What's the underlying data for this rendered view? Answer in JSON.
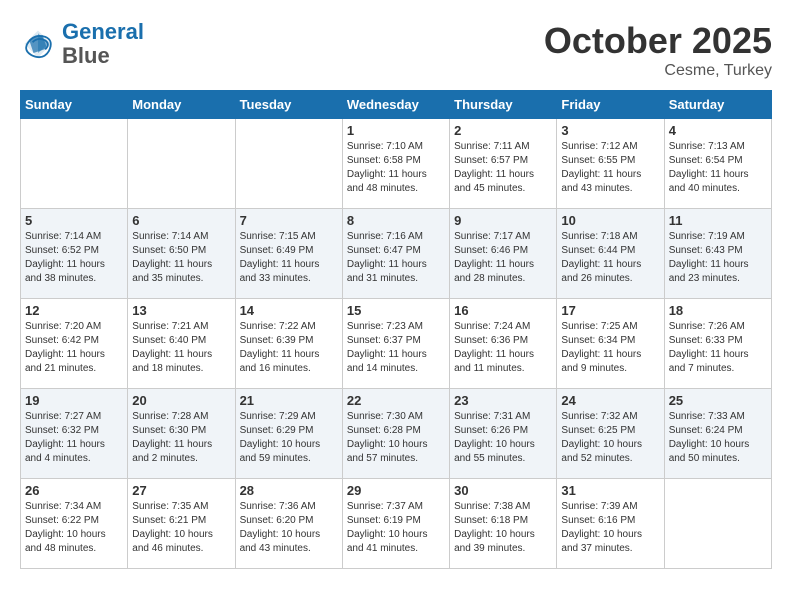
{
  "header": {
    "logo_line1": "General",
    "logo_line2": "Blue",
    "month": "October 2025",
    "location": "Cesme, Turkey"
  },
  "weekdays": [
    "Sunday",
    "Monday",
    "Tuesday",
    "Wednesday",
    "Thursday",
    "Friday",
    "Saturday"
  ],
  "weeks": [
    [
      {
        "day": "",
        "info": ""
      },
      {
        "day": "",
        "info": ""
      },
      {
        "day": "",
        "info": ""
      },
      {
        "day": "1",
        "info": "Sunrise: 7:10 AM\nSunset: 6:58 PM\nDaylight: 11 hours\nand 48 minutes."
      },
      {
        "day": "2",
        "info": "Sunrise: 7:11 AM\nSunset: 6:57 PM\nDaylight: 11 hours\nand 45 minutes."
      },
      {
        "day": "3",
        "info": "Sunrise: 7:12 AM\nSunset: 6:55 PM\nDaylight: 11 hours\nand 43 minutes."
      },
      {
        "day": "4",
        "info": "Sunrise: 7:13 AM\nSunset: 6:54 PM\nDaylight: 11 hours\nand 40 minutes."
      }
    ],
    [
      {
        "day": "5",
        "info": "Sunrise: 7:14 AM\nSunset: 6:52 PM\nDaylight: 11 hours\nand 38 minutes."
      },
      {
        "day": "6",
        "info": "Sunrise: 7:14 AM\nSunset: 6:50 PM\nDaylight: 11 hours\nand 35 minutes."
      },
      {
        "day": "7",
        "info": "Sunrise: 7:15 AM\nSunset: 6:49 PM\nDaylight: 11 hours\nand 33 minutes."
      },
      {
        "day": "8",
        "info": "Sunrise: 7:16 AM\nSunset: 6:47 PM\nDaylight: 11 hours\nand 31 minutes."
      },
      {
        "day": "9",
        "info": "Sunrise: 7:17 AM\nSunset: 6:46 PM\nDaylight: 11 hours\nand 28 minutes."
      },
      {
        "day": "10",
        "info": "Sunrise: 7:18 AM\nSunset: 6:44 PM\nDaylight: 11 hours\nand 26 minutes."
      },
      {
        "day": "11",
        "info": "Sunrise: 7:19 AM\nSunset: 6:43 PM\nDaylight: 11 hours\nand 23 minutes."
      }
    ],
    [
      {
        "day": "12",
        "info": "Sunrise: 7:20 AM\nSunset: 6:42 PM\nDaylight: 11 hours\nand 21 minutes."
      },
      {
        "day": "13",
        "info": "Sunrise: 7:21 AM\nSunset: 6:40 PM\nDaylight: 11 hours\nand 18 minutes."
      },
      {
        "day": "14",
        "info": "Sunrise: 7:22 AM\nSunset: 6:39 PM\nDaylight: 11 hours\nand 16 minutes."
      },
      {
        "day": "15",
        "info": "Sunrise: 7:23 AM\nSunset: 6:37 PM\nDaylight: 11 hours\nand 14 minutes."
      },
      {
        "day": "16",
        "info": "Sunrise: 7:24 AM\nSunset: 6:36 PM\nDaylight: 11 hours\nand 11 minutes."
      },
      {
        "day": "17",
        "info": "Sunrise: 7:25 AM\nSunset: 6:34 PM\nDaylight: 11 hours\nand 9 minutes."
      },
      {
        "day": "18",
        "info": "Sunrise: 7:26 AM\nSunset: 6:33 PM\nDaylight: 11 hours\nand 7 minutes."
      }
    ],
    [
      {
        "day": "19",
        "info": "Sunrise: 7:27 AM\nSunset: 6:32 PM\nDaylight: 11 hours\nand 4 minutes."
      },
      {
        "day": "20",
        "info": "Sunrise: 7:28 AM\nSunset: 6:30 PM\nDaylight: 11 hours\nand 2 minutes."
      },
      {
        "day": "21",
        "info": "Sunrise: 7:29 AM\nSunset: 6:29 PM\nDaylight: 10 hours\nand 59 minutes."
      },
      {
        "day": "22",
        "info": "Sunrise: 7:30 AM\nSunset: 6:28 PM\nDaylight: 10 hours\nand 57 minutes."
      },
      {
        "day": "23",
        "info": "Sunrise: 7:31 AM\nSunset: 6:26 PM\nDaylight: 10 hours\nand 55 minutes."
      },
      {
        "day": "24",
        "info": "Sunrise: 7:32 AM\nSunset: 6:25 PM\nDaylight: 10 hours\nand 52 minutes."
      },
      {
        "day": "25",
        "info": "Sunrise: 7:33 AM\nSunset: 6:24 PM\nDaylight: 10 hours\nand 50 minutes."
      }
    ],
    [
      {
        "day": "26",
        "info": "Sunrise: 7:34 AM\nSunset: 6:22 PM\nDaylight: 10 hours\nand 48 minutes."
      },
      {
        "day": "27",
        "info": "Sunrise: 7:35 AM\nSunset: 6:21 PM\nDaylight: 10 hours\nand 46 minutes."
      },
      {
        "day": "28",
        "info": "Sunrise: 7:36 AM\nSunset: 6:20 PM\nDaylight: 10 hours\nand 43 minutes."
      },
      {
        "day": "29",
        "info": "Sunrise: 7:37 AM\nSunset: 6:19 PM\nDaylight: 10 hours\nand 41 minutes."
      },
      {
        "day": "30",
        "info": "Sunrise: 7:38 AM\nSunset: 6:18 PM\nDaylight: 10 hours\nand 39 minutes."
      },
      {
        "day": "31",
        "info": "Sunrise: 7:39 AM\nSunset: 6:16 PM\nDaylight: 10 hours\nand 37 minutes."
      },
      {
        "day": "",
        "info": ""
      }
    ]
  ]
}
